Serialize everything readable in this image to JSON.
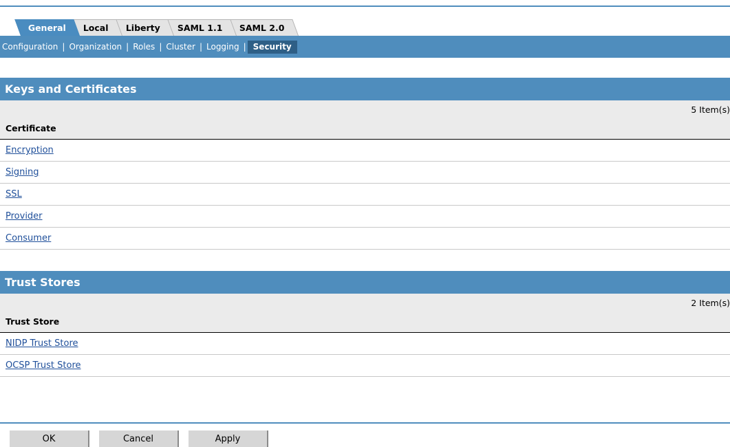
{
  "tabs": [
    {
      "label": "General",
      "active": true
    },
    {
      "label": "Local",
      "active": false
    },
    {
      "label": "Liberty",
      "active": false
    },
    {
      "label": "SAML 1.1",
      "active": false
    },
    {
      "label": "SAML 2.0",
      "active": false
    }
  ],
  "subnav": {
    "items": [
      "Configuration",
      "Organization",
      "Roles",
      "Cluster",
      "Logging",
      "Security"
    ],
    "separator": "|",
    "active": "Security"
  },
  "keys_section": {
    "title": "Keys and Certificates",
    "count": "5 Item(s)",
    "column": "Certificate",
    "rows": [
      "Encryption",
      "Signing",
      "SSL",
      "Provider",
      "Consumer"
    ]
  },
  "trust_section": {
    "title": "Trust Stores",
    "count": "2 Item(s)",
    "column": "Trust Store",
    "rows": [
      "NIDP Trust Store",
      "OCSP Trust Store"
    ]
  },
  "buttons": {
    "ok": "OK",
    "cancel": "Cancel",
    "apply": "Apply"
  },
  "colors": {
    "accent": "#4f8dbd",
    "active_subnav": "#2e5f86",
    "link": "#1f4f9a"
  }
}
